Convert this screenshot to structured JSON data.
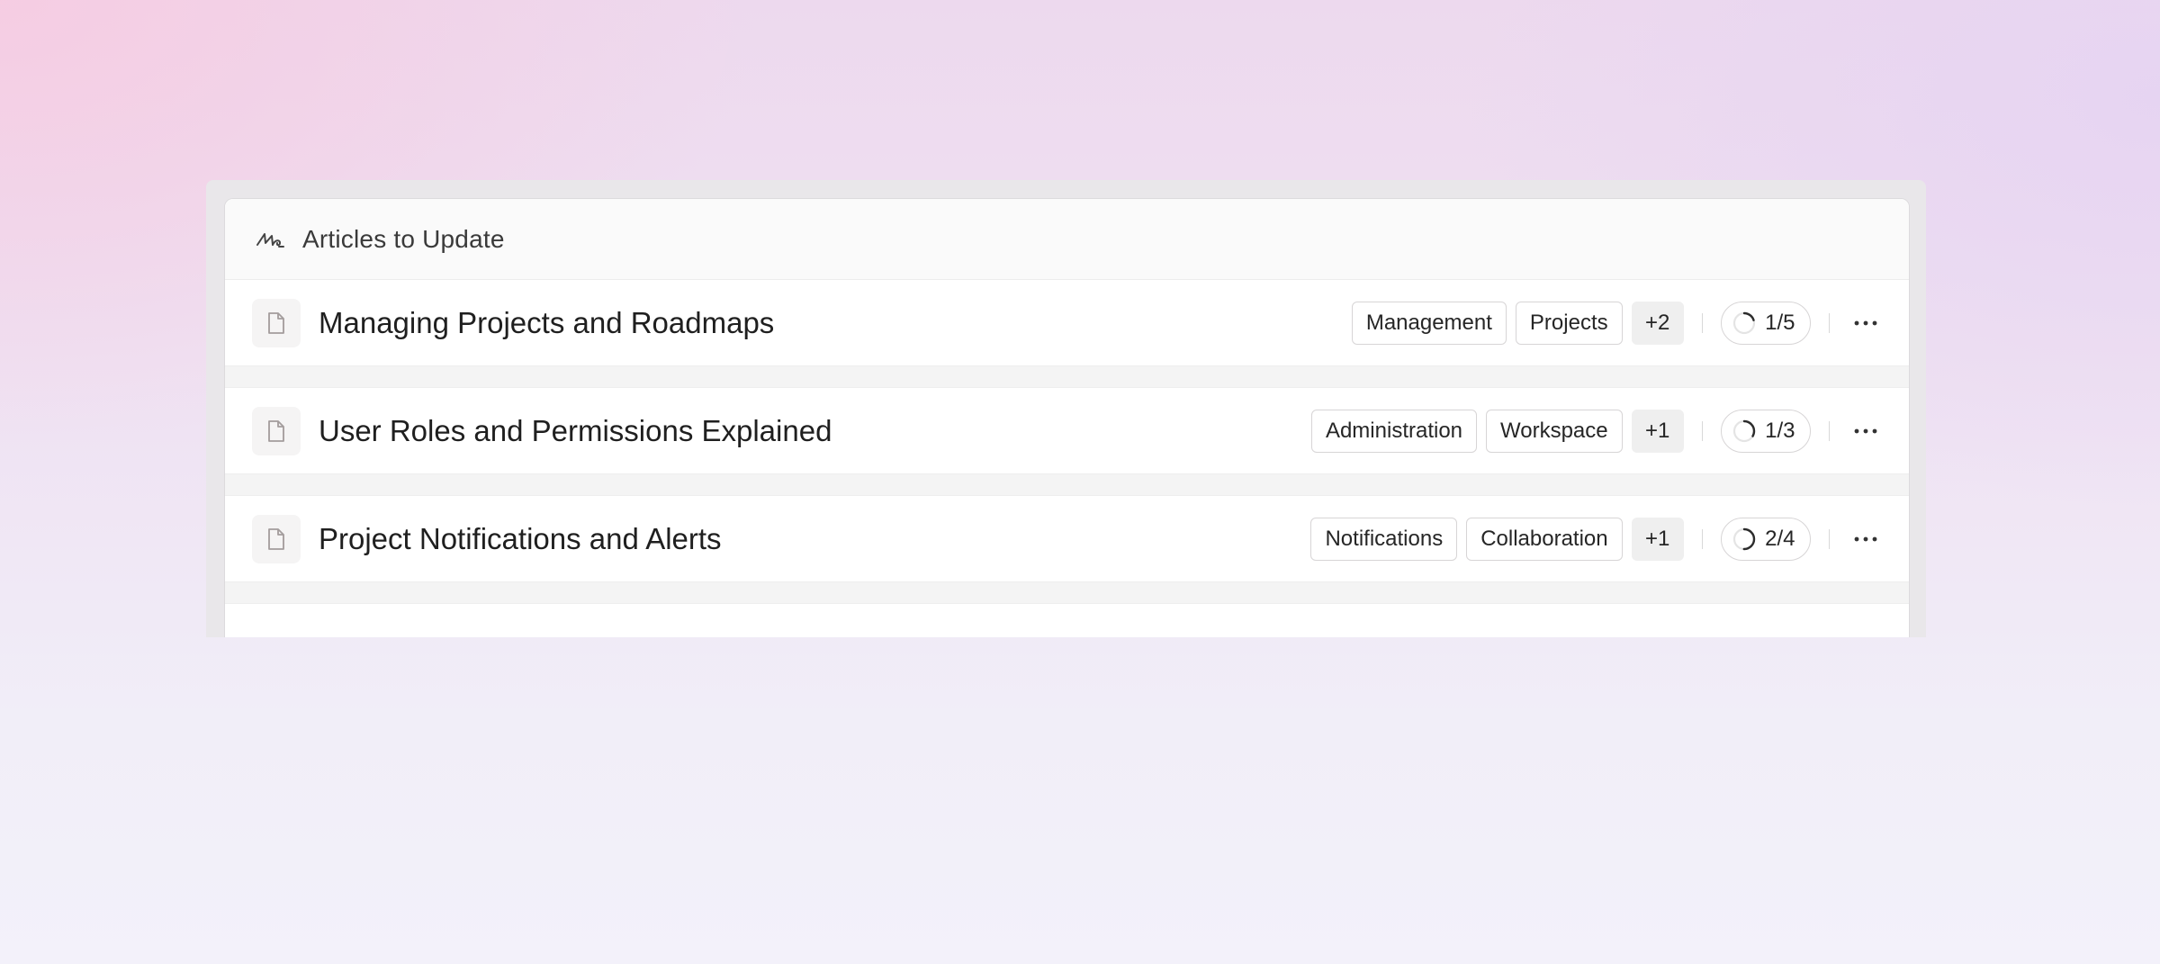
{
  "card": {
    "title": "Articles to Update",
    "icon": "signature-icon"
  },
  "articles": [
    {
      "title": "Managing Projects and Roadmaps",
      "icon": "document-icon",
      "tags": [
        "Management",
        "Projects"
      ],
      "more_tags": "+2",
      "progress_label": "1/5",
      "progress_fraction": 0.2
    },
    {
      "title": "User Roles and Permissions Explained",
      "icon": "document-icon",
      "tags": [
        "Administration",
        "Workspace"
      ],
      "more_tags": "+1",
      "progress_label": "1/3",
      "progress_fraction": 0.333
    },
    {
      "title": "Project Notifications and Alerts",
      "icon": "document-icon",
      "tags": [
        "Notifications",
        "Collaboration"
      ],
      "more_tags": "+1",
      "progress_label": "2/4",
      "progress_fraction": 0.5
    }
  ],
  "colors": {
    "progress_track": "#e4e4e4",
    "progress_fill": "#2b2b2b",
    "card_header_bg": "#fafafa"
  }
}
